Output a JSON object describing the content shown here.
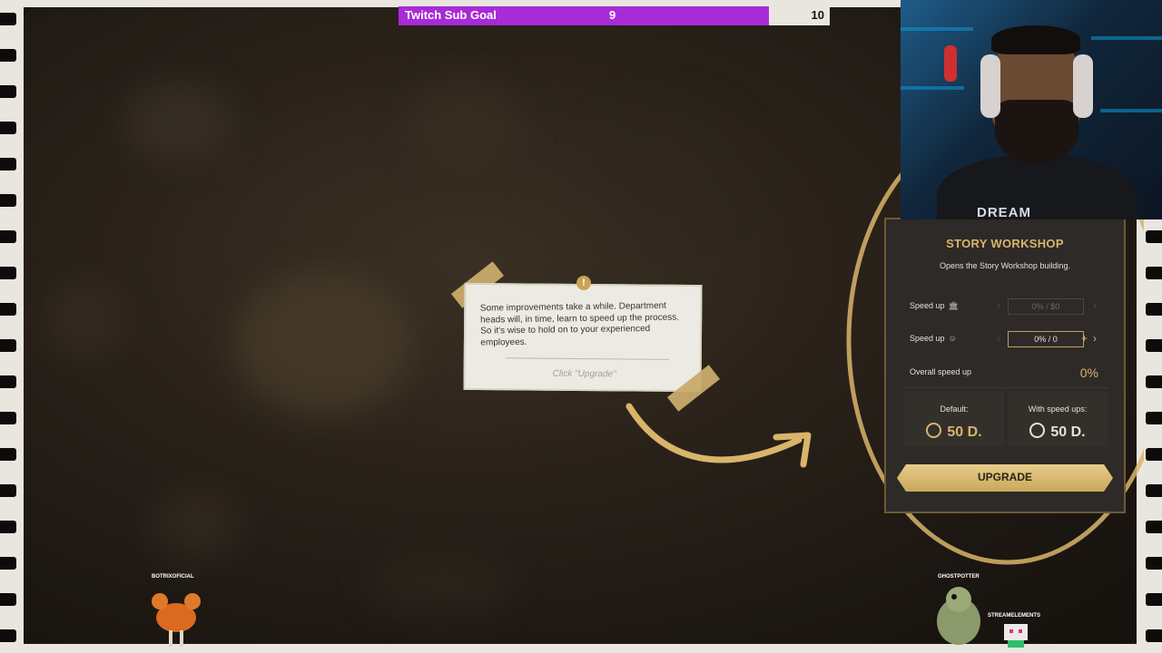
{
  "subgoal": {
    "label": "Twitch Sub Goal",
    "current": "9",
    "target": "10",
    "progress": 0.9,
    "fill_color": "#a72bd6"
  },
  "tooltip": {
    "text": "Some improvements take a while. Department heads will, in time, learn to speed up the process. So it's wise to hold on to your experienced employees.",
    "cta": "Click \"Upgrade\"",
    "badge": "!"
  },
  "panel": {
    "title": "STORY WORKSHOP",
    "subtitle": "Opens the Story Workshop building.",
    "speedup_money_label": "Speed up",
    "speedup_money_icon": "bank-icon",
    "speedup_money_value": "0% / $0",
    "speedup_staff_label": "Speed up",
    "speedup_staff_icon": "person-icon",
    "speedup_staff_value": "0% / 0",
    "overall_label": "Overall speed up",
    "overall_value": "0%",
    "default_label": "Default:",
    "default_value": "50 D.",
    "with_label": "With speed ups:",
    "with_value": "50 D.",
    "upgrade_label": "UPGRADE",
    "accent": "#d9b56a"
  },
  "webcam": {
    "shirt_text": "DREAM"
  },
  "pets": [
    {
      "name": "BOTRIXOFICIAL"
    },
    {
      "name": "GHOSTPOTTER"
    },
    {
      "name": "STREAMELEMENTS"
    }
  ]
}
